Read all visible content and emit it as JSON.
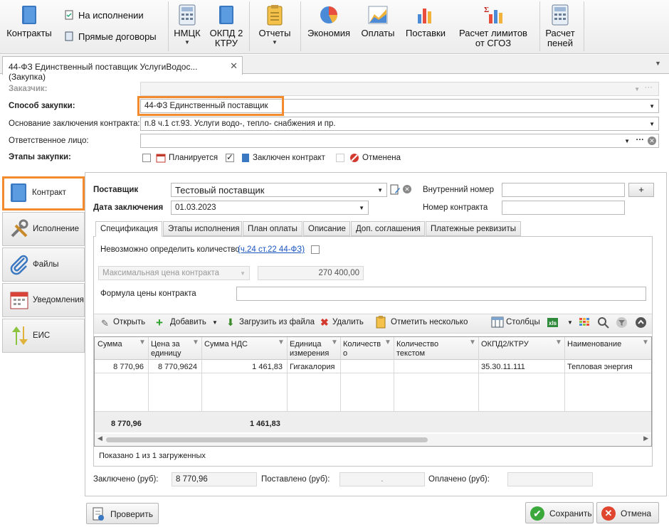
{
  "ribbon": {
    "contracts": "Контракты",
    "in_progress": "На исполнении",
    "direct_contracts": "Прямые договоры",
    "nmck": "НМЦК",
    "okpd_1": "ОКПД 2",
    "okpd_2": "КТРУ",
    "reports": "Отчеты",
    "economy": "Экономия",
    "payments": "Оплаты",
    "deliveries": "Поставки",
    "limits_1": "Расчет лимитов",
    "limits_2": "от СГОЗ",
    "penalty_1": "Расчет",
    "penalty_2": "пеней"
  },
  "tab": {
    "title": "44-ФЗ Единственный поставщик УслугиВодос... (Закупка)",
    "close": "✕"
  },
  "form": {
    "customer_label": "Заказчик:",
    "method_label": "Способ закупки:",
    "method_value": "44-ФЗ Единственный поставщик",
    "basis_label": "Основание заключения контракта:",
    "basis_value": "п.8 ч.1 ст.93. Услуги водо-, тепло- снабжения и пр.",
    "responsible_label": "Ответственное лицо:",
    "stages_label": "Этапы закупки:",
    "stage_planned": "Планируется",
    "stage_signed": "Заключен контракт",
    "stage_cancelled": "Отменена"
  },
  "nav": {
    "contract": "Контракт",
    "execution": "Исполнение",
    "files": "Файлы",
    "notifications": "Уведомления",
    "eis": "ЕИС"
  },
  "contract": {
    "supplier_label": "Поставщик",
    "supplier_value": "Тестовый поставщик",
    "date_label": "Дата заключения",
    "date_value": "01.03.2023",
    "internal_no_label": "Внутренний номер",
    "contract_no_label": "Номер контракта",
    "plus": "+"
  },
  "inner_tabs": [
    "Спецификация",
    "Этапы исполнения",
    "План оплаты",
    "Описание",
    "Доп. соглашения",
    "Платежные реквизиты"
  ],
  "spec": {
    "qty_label": "Невозможно определить количество",
    "qty_link": "(ч.24 ст.22 44-ФЗ)",
    "price_type": "Максимальная цена контракта",
    "price_value": "270 400,00",
    "formula_label": "Формула цены контракта"
  },
  "toolbar": {
    "open": "Открыть",
    "add": "Добавить",
    "load": "Загрузить из файла",
    "delete": "Удалить",
    "mark": "Отметить несколько",
    "columns": "Столбцы"
  },
  "grid": {
    "headers": [
      [
        "Сумма",
        ""
      ],
      [
        "Цена за",
        "единицу"
      ],
      [
        "Сумма НДС",
        ""
      ],
      [
        "Единица",
        "измерения"
      ],
      [
        "Количеств",
        "о"
      ],
      [
        "Количество",
        "текстом"
      ],
      [
        "ОКПД2/КТРУ",
        ""
      ],
      [
        "Наименование",
        ""
      ]
    ],
    "row": [
      "8 770,96",
      "8 770,9624",
      "1 461,83",
      "Гигакалория",
      "",
      "",
      "35.30.11.111",
      "Тепловая энергия"
    ],
    "totals": {
      "sum": "8 770,96",
      "vat": "1 461,83"
    },
    "footer": "Показано 1 из 1 загруженных"
  },
  "summary": {
    "signed_label": "Заключено (руб):",
    "signed_value": "8 770,96",
    "delivered_label": "Поставлено (руб):",
    "delivered_value": ".",
    "paid_label": "Оплачено (руб):"
  },
  "buttons": {
    "check": "Проверить",
    "save": "Сохранить",
    "cancel": "Отмена"
  },
  "colors": {
    "accent_orange": "#f28a2e",
    "link": "#1a55c0"
  }
}
